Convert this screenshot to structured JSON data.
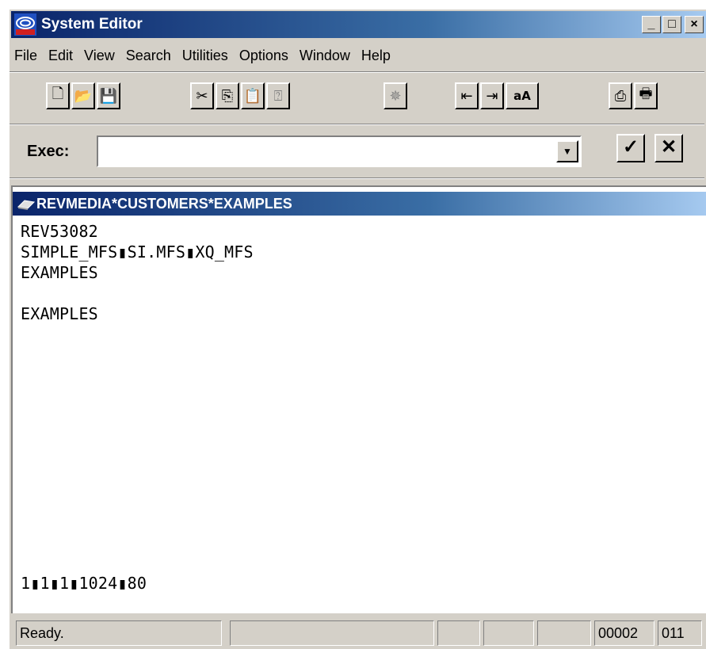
{
  "window": {
    "title": "System Editor",
    "controls": {
      "minimize": "_",
      "maximize": "□",
      "close": "×"
    }
  },
  "menu": [
    "File",
    "Edit",
    "View",
    "Search",
    "Utilities",
    "Options",
    "Window",
    "Help"
  ],
  "toolbar": {
    "file_group": [
      {
        "icon": "new-document-icon",
        "glyph": "🗋"
      },
      {
        "icon": "open-folder-icon",
        "glyph": "📂"
      },
      {
        "icon": "save-icon",
        "glyph": "💾"
      }
    ],
    "edit_group": [
      {
        "icon": "cut-icon",
        "glyph": "✂"
      },
      {
        "icon": "copy-icon",
        "glyph": "⎘"
      },
      {
        "icon": "paste-icon",
        "glyph": "📋"
      },
      {
        "icon": "paste-special-icon",
        "glyph": "⍰"
      }
    ],
    "tool_group": [
      {
        "icon": "magic-wand-icon",
        "glyph": "✵"
      }
    ],
    "format_group": [
      {
        "icon": "outdent-icon",
        "glyph": "⇤"
      },
      {
        "icon": "indent-icon",
        "glyph": "⇥"
      },
      {
        "icon": "case-toggle-icon",
        "glyph": "aA"
      }
    ],
    "print_group": [
      {
        "icon": "print-preview-icon",
        "glyph": "⎙"
      },
      {
        "icon": "print-icon",
        "glyph": "🖶"
      }
    ]
  },
  "exec": {
    "label": "Exec:",
    "value": "",
    "dropdown_glyph": "▼",
    "ok_glyph": "✓",
    "cancel_glyph": "✕"
  },
  "document": {
    "title": "REVMEDIA*CUSTOMERS*EXAMPLES",
    "lines": [
      "REV53082",
      "SIMPLE_MFS▮SI.MFS▮XQ_MFS",
      "EXAMPLES",
      "",
      "EXAMPLES"
    ],
    "footer_line": "1▮1▮1▮1024▮80"
  },
  "status": {
    "message": "Ready.",
    "line": "00002",
    "column": "011"
  },
  "colors": {
    "titlebar_start": "#0a246a",
    "titlebar_end": "#a6caf0",
    "face": "#d4d0c8"
  }
}
